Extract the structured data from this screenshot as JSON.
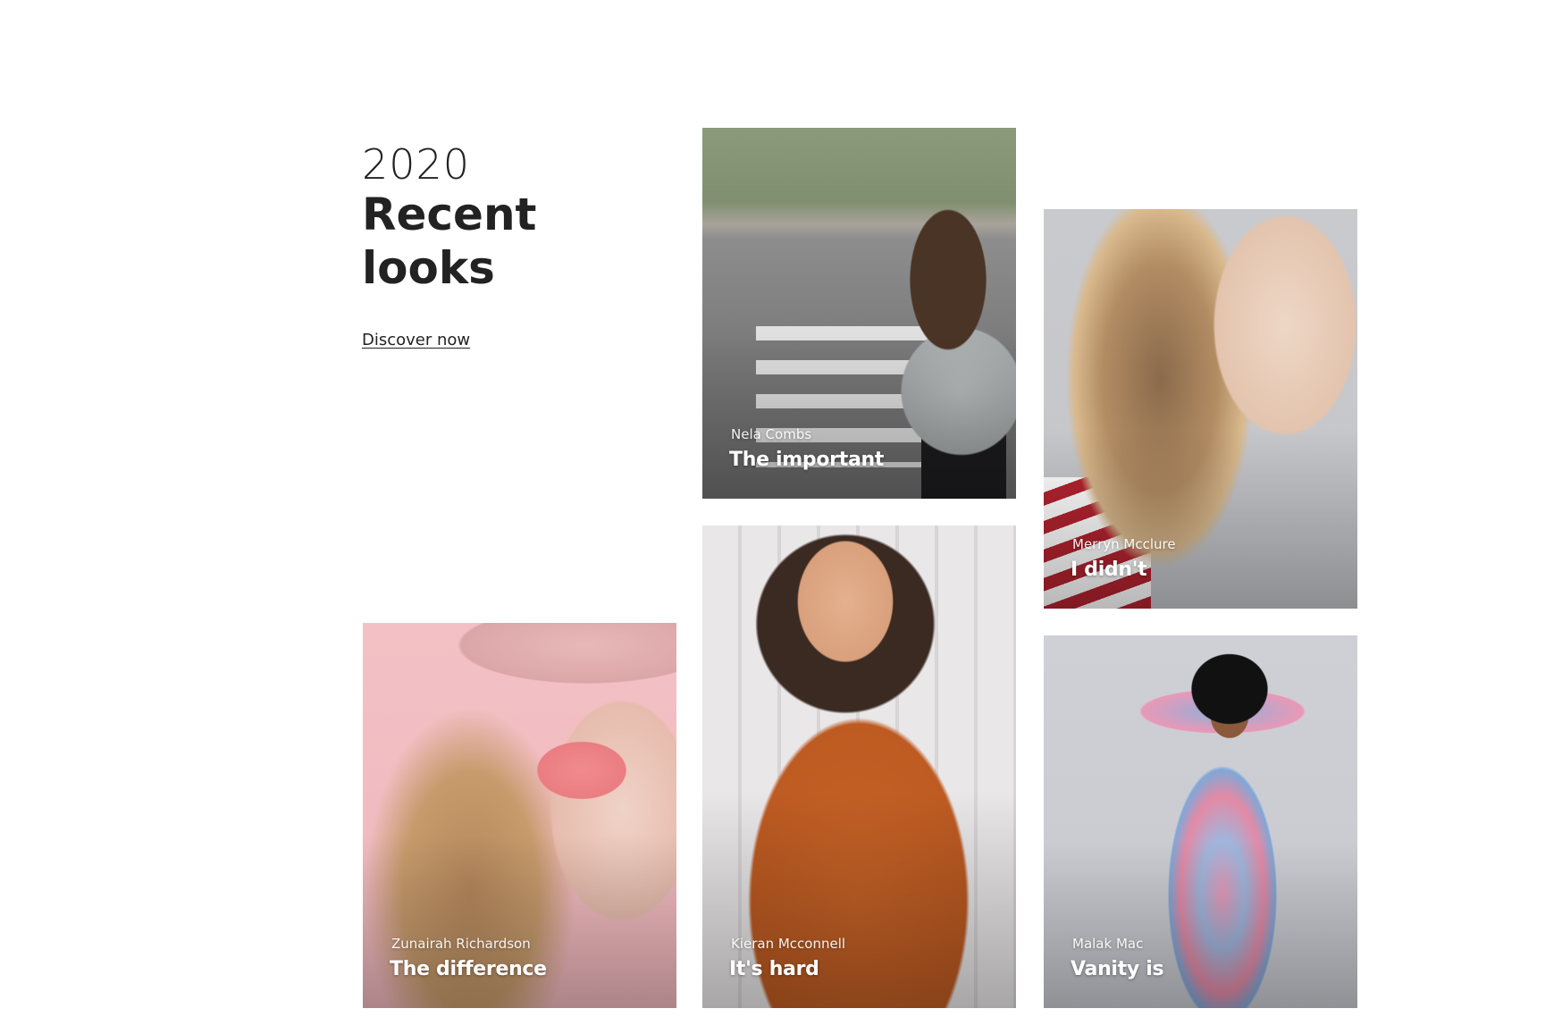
{
  "hero": {
    "year": "2020",
    "title": "Recent looks",
    "link_label": "Discover now"
  },
  "cards": [
    {
      "author": "Nela Combs",
      "title": "The important"
    },
    {
      "author": "Merryn Mcclure",
      "title": "I didn't"
    },
    {
      "author": "Zunairah Richardson",
      "title": "The difference"
    },
    {
      "author": "Kieran Mcconnell",
      "title": "It's hard"
    },
    {
      "author": "Malak Mac",
      "title": "Vanity is"
    }
  ]
}
